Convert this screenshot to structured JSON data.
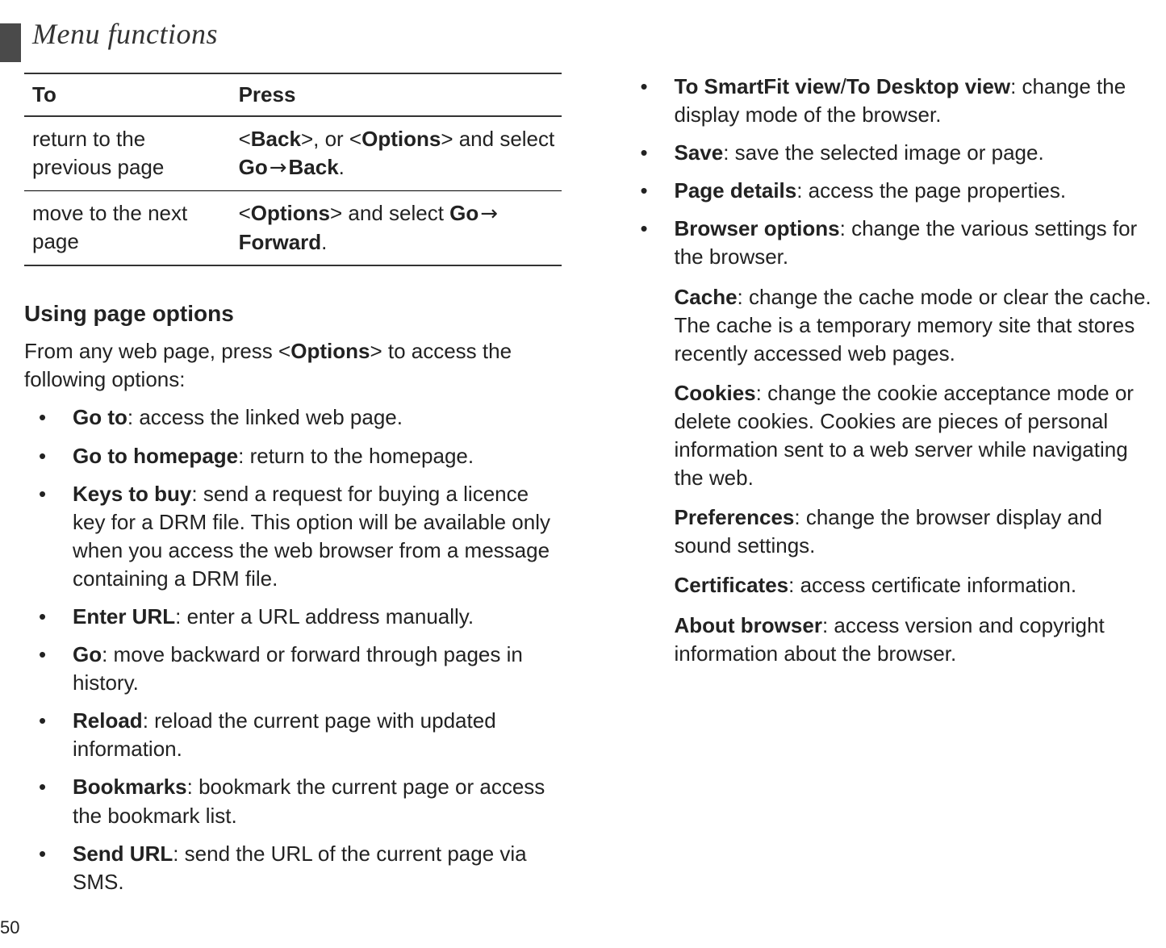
{
  "header": {
    "title": "Menu functions"
  },
  "pageNumber": "50",
  "table": {
    "headers": {
      "to": "To",
      "press": "Press"
    },
    "rows": [
      {
        "to": "return to the previous page",
        "press_parts": {
          "p1": "<",
          "p2": "Back",
          "p3": ">, or <",
          "p4": "Options",
          "p5": "> and select ",
          "p6": "Go",
          "p7": " → ",
          "p8": "Back",
          "p9": "."
        }
      },
      {
        "to": "move to the next page",
        "press_parts": {
          "p1": "<",
          "p2": "Options",
          "p3": "> and select ",
          "p4": "Go",
          "p5": " → ",
          "p6": "Forward",
          "p7": "."
        }
      }
    ]
  },
  "section": {
    "heading": "Using page options",
    "intro": {
      "t1": "From any web page, press <",
      "t2": "Options",
      "t3": "> to access the following options:"
    },
    "items": [
      {
        "name": "Go to",
        "desc": ": access the linked web page."
      },
      {
        "name": "Go to homepage",
        "desc": ": return to the homepage."
      },
      {
        "name": "Keys to buy",
        "desc": ": send a request for buying a licence key for a DRM file. This option will be available only when you access the web browser from a message containing a DRM file."
      },
      {
        "name": "Enter URL",
        "desc": ": enter a URL address manually."
      },
      {
        "name": "Go",
        "desc": ": move backward or forward through pages in history."
      },
      {
        "name": "Reload",
        "desc": ": reload the current page with updated information."
      },
      {
        "name": "Bookmarks",
        "desc": ": bookmark the current page or access the bookmark list."
      },
      {
        "name": "Send URL",
        "desc": ": send the URL of the current page via SMS."
      },
      {
        "name": "To SmartFit view",
        "sep": "/",
        "name2": "To Desktop view",
        "desc": ": change the display mode of the browser."
      },
      {
        "name": "Save",
        "desc": ": save the selected image or page."
      },
      {
        "name": "Page details",
        "desc": ": access the page properties."
      },
      {
        "name": "Browser options",
        "desc": ": change the various settings for the browser.",
        "subs": [
          {
            "name": "Cache",
            "desc": ": change the cache mode or clear the cache. The cache is a temporary memory site that stores recently accessed web pages."
          },
          {
            "name": "Cookies",
            "desc": ": change the cookie acceptance mode or delete cookies. Cookies are pieces of personal information sent to a web server while navigating the web."
          },
          {
            "name": "Preferences",
            "desc": ": change the browser display and sound settings."
          },
          {
            "name": "Certificates",
            "desc": ": access certificate information."
          },
          {
            "name": "About browser",
            "desc": ": access version and copyright information about the browser."
          }
        ]
      }
    ]
  }
}
